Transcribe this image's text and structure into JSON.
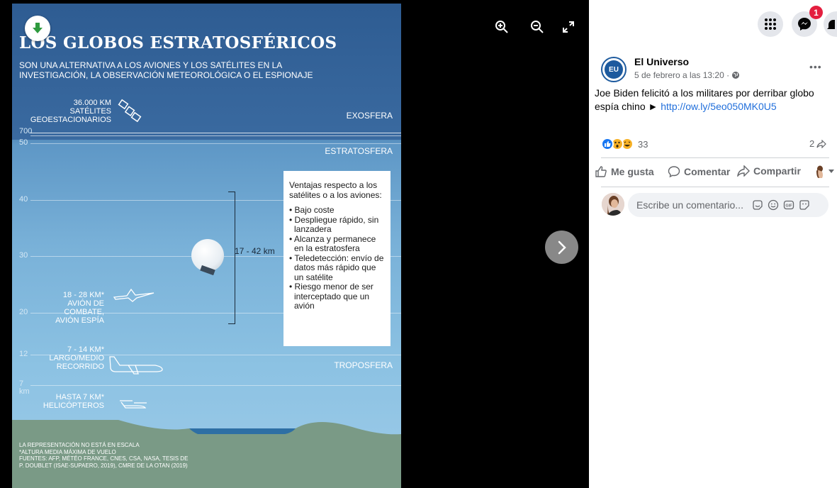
{
  "infographic": {
    "title": "LOS GLOBOS ESTRATOSFÉRICOS",
    "subtitle": "SON UNA ALTERNATIVA A LOS AVIONES Y LOS SATÉLITES EN LA INVESTIGACIÓN, LA OBSERVACIÓN METEOROLÓGICA O EL ESPIONAJE",
    "satellites_label_1": "36.000 KM",
    "satellites_label_2": "SATÉLITES",
    "satellites_label_3": "GEOESTACIONARIOS",
    "alt_700": "700",
    "alt_50": "50",
    "alt_40": "40",
    "alt_30": "30",
    "alt_20": "20",
    "alt_12": "12",
    "alt_7": "7",
    "alt_km": "km",
    "layer_exosfera": "EXOSFERA",
    "layer_estratosfera": "ESTRATOSFERA",
    "layer_troposfera": "TROPOSFERA",
    "balloon_range": "17 - 42 km",
    "advantages_title": "Ventajas respecto a los satélites o a los aviones:",
    "advantages": [
      "• Bajo coste",
      "• Despliegue rápido, sin lanzadera",
      "• Alcanza y permanece en la estratosfera",
      "• Teledetección: envío de datos más rápido que un satélite",
      "• Riesgo menor de ser interceptado que un avión"
    ],
    "fighter_1": "18 - 28 KM*",
    "fighter_2": "AVIÓN DE",
    "fighter_3": "COMBATE,",
    "fighter_4": "AVIÓN ESPÍA",
    "airliner_1": "7 - 14 KM*",
    "airliner_2": "LARGO/MEDIO",
    "airliner_3": "RECORRIDO",
    "heli_1": "HASTA 7 KM*",
    "heli_2": "HELICÓPTEROS",
    "footnote_1": "LA REPRESENTACIÓN NO ESTÁ EN ESCALA",
    "footnote_2": "*ALTURA MEDIA MÁXIMA DE VUELO",
    "footnote_3": "FUENTES: AFP, MÉTÉO FRANCE, CNES, CSA, NASA, TESIS DE",
    "footnote_4": "P. DOUBLET (ISAE-SUPAERO, 2019), CMRE DE LA OTAN (2019)"
  },
  "post": {
    "page_name": "El Universo",
    "avatar_text": "EU",
    "date": "5 de febrero a las 13:20 ·",
    "text": "Joe Biden felicitó a los militares por derribar globo espía chino ► ",
    "link": "http://ow.ly/5eo050MK0U5",
    "reaction_count": "33",
    "share_count": "2",
    "like_label": "Me gusta",
    "comment_label": "Comentar",
    "share_label": "Compartir",
    "comment_placeholder": "Escribe un comentario..."
  },
  "topbar": {
    "notification_count": "1"
  },
  "colors": {
    "fb_blue": "#216fdb",
    "badge_red": "#e41e3f",
    "brand_blue": "#1d5a9e"
  }
}
